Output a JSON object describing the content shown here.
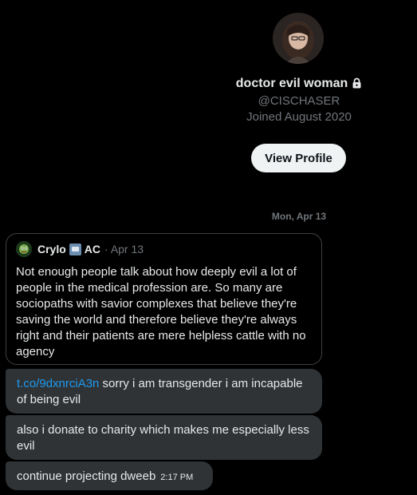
{
  "profile": {
    "name": "doctor evil woman",
    "handle": "@CISCHASER",
    "joined": "Joined August 2020",
    "view_profile_label": "View Profile"
  },
  "conversation": {
    "date_separator": "Mon, Apr 13",
    "quoted_post": {
      "author_name": "Crylo",
      "author_tag": "AC",
      "date": "Apr 13",
      "text": "Not enough people talk about how deeply evil a lot of people in the medical profession are. So many are sociopaths with savior complexes that believe they're saving the world and therefore believe they're always right and their patients are mere helpless cattle with no agency",
      "badge_icon": "new-badge-icon"
    },
    "messages": [
      {
        "link": "t.co/9dxnrciA3n",
        "text": " sorry i am transgender i am incapable of being evil"
      },
      {
        "text": "also i donate to charity which makes me especially less evil"
      },
      {
        "text": "continue projecting dweeb",
        "time": "2:17 PM"
      }
    ]
  },
  "icons": {
    "lock": "lock-icon",
    "avatar": "profile-avatar"
  },
  "colors": {
    "background": "#000000",
    "bubble": "#2f3336",
    "link": "#1d9bf0",
    "muted": "#71767b",
    "button_bg": "#eff3f4"
  }
}
